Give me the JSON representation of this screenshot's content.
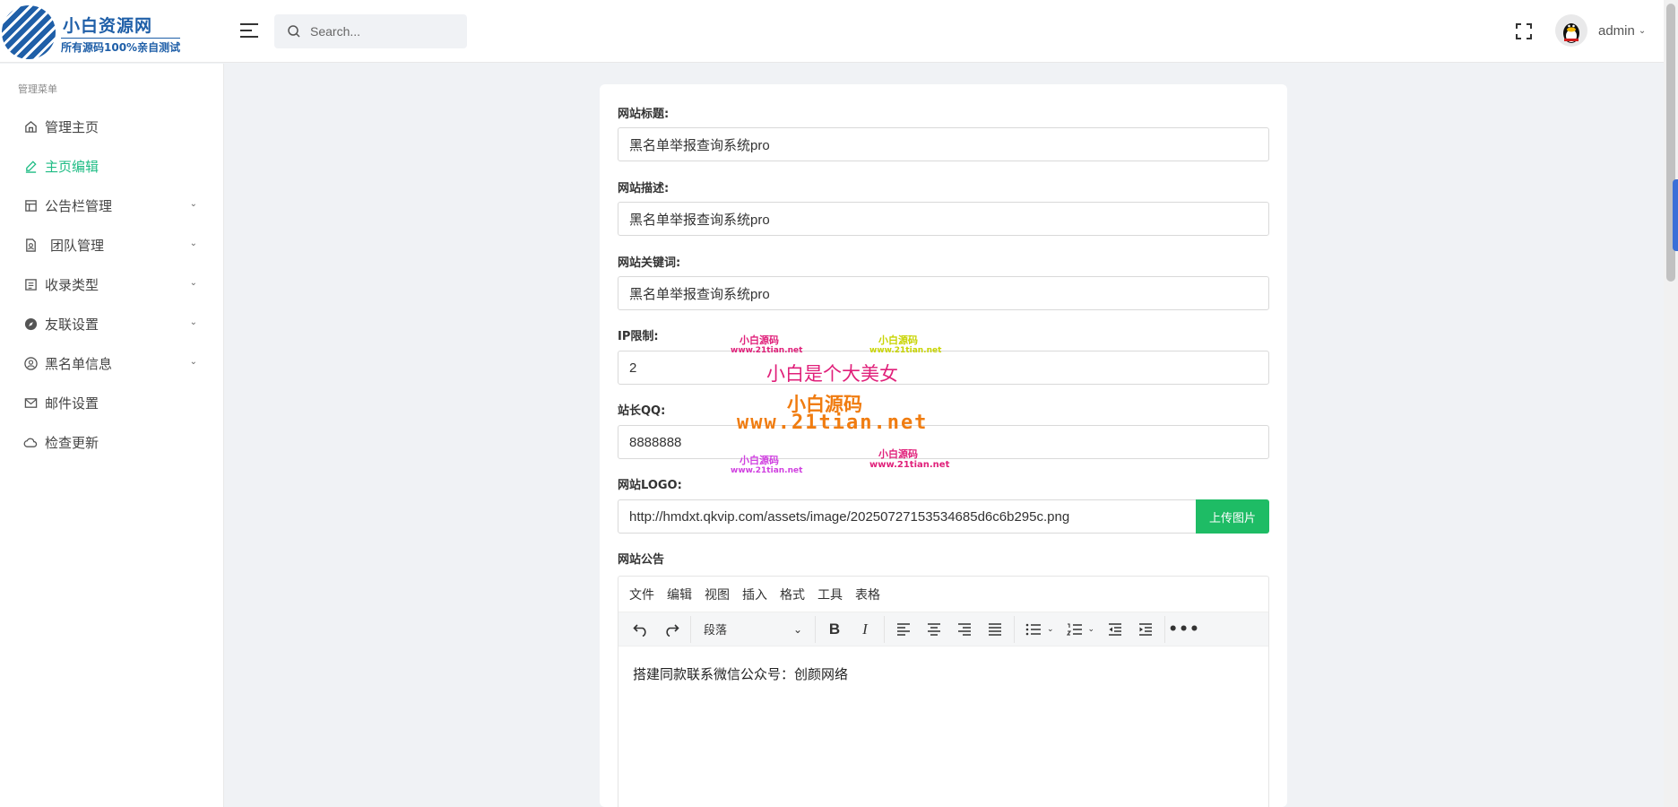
{
  "header": {
    "logo_title": "小白资源网",
    "logo_subtitle": "所有源码100%亲自测试",
    "search_placeholder": "Search...",
    "user_name": "admin"
  },
  "sidebar": {
    "heading": "管理菜单",
    "items": [
      {
        "label": "管理主页",
        "icon": "home-icon",
        "expandable": false,
        "active": false
      },
      {
        "label": "主页编辑",
        "icon": "edit-icon",
        "expandable": false,
        "active": true
      },
      {
        "label": "公告栏管理",
        "icon": "board-icon",
        "expandable": true,
        "active": false
      },
      {
        "label": "团队管理",
        "icon": "team-file-icon",
        "expandable": true,
        "active": false
      },
      {
        "label": "收录类型",
        "icon": "list-box-icon",
        "expandable": true,
        "active": false
      },
      {
        "label": "友联设置",
        "icon": "compass-icon",
        "expandable": true,
        "active": false
      },
      {
        "label": "黑名单信息",
        "icon": "user-circle-icon",
        "expandable": true,
        "active": false
      },
      {
        "label": "邮件设置",
        "icon": "mail-icon",
        "expandable": false,
        "active": false
      },
      {
        "label": "检查更新",
        "icon": "cloud-icon",
        "expandable": false,
        "active": false
      }
    ]
  },
  "form": {
    "site_title": {
      "label": "网站标题:",
      "value": "黑名单举报查询系统pro"
    },
    "site_desc": {
      "label": "网站描述:",
      "value": "黑名单举报查询系统pro"
    },
    "site_keywords": {
      "label": "网站关键词:",
      "value": "黑名单举报查询系统pro"
    },
    "ip_limit": {
      "label": "IP限制:",
      "value": "2"
    },
    "admin_qq": {
      "label": "站长QQ:",
      "value": "8888888"
    },
    "site_logo": {
      "label": "网站LOGO:",
      "value": "http://hmdxt.qkvip.com/assets/image/20250727153534685d6c6b295c.png",
      "button": "上传图片"
    },
    "notice": {
      "label": "网站公告"
    }
  },
  "editor": {
    "menus": [
      "文件",
      "编辑",
      "视图",
      "插入",
      "格式",
      "工具",
      "表格"
    ],
    "block_format": "段落",
    "content": "搭建同款联系微信公众号：创颜网络"
  },
  "watermarks": {
    "small_cn_1": "小白源码",
    "small_url_1": "www.21tian.net",
    "small_cn_2": "小白源码",
    "small_url_2": "www.21tian.net",
    "main_slogan": "小白是个大美女",
    "big_cn": "小白源码",
    "big_url": "www.21tian.net",
    "small_cn_3": "小白源码",
    "small_url_3": "www.21tian.net",
    "small_cn_4": "小白源码",
    "small_url_4": "www.21tian.net"
  },
  "colors": {
    "accent": "#1ebc84",
    "upload_button": "#1ebc65",
    "brand_blue": "#1f5fa8"
  }
}
